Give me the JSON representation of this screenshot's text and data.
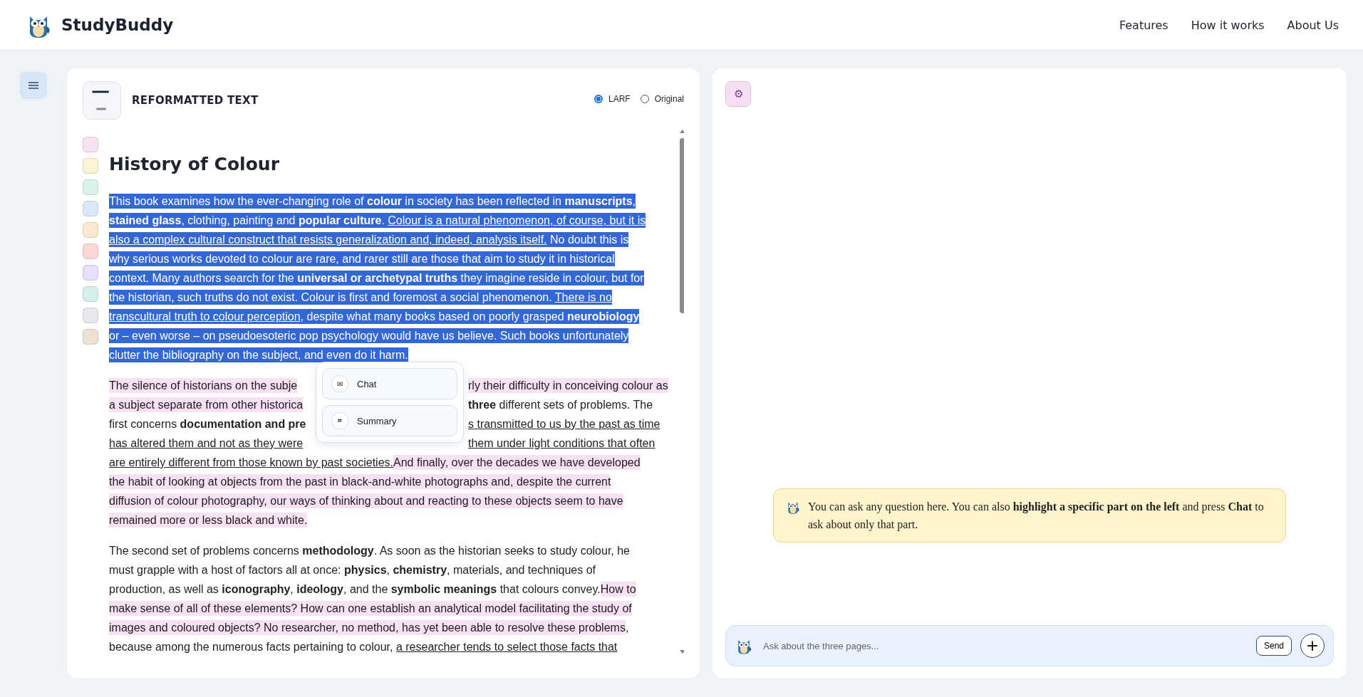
{
  "header": {
    "brand": "StudyBuddy",
    "nav": [
      {
        "label": "Features"
      },
      {
        "label": "How it works"
      },
      {
        "label": "About Us"
      }
    ]
  },
  "reader": {
    "title": "REFORMATTED TEXT",
    "modes": [
      {
        "label": "LARF",
        "selected": true
      },
      {
        "label": "Original",
        "selected": false
      }
    ],
    "swatches": [
      {
        "color": "#f7e3f4"
      },
      {
        "color": "#fcf3d3"
      },
      {
        "color": "#d8f5e7"
      },
      {
        "color": "#dbe8fb"
      },
      {
        "color": "#fde9cf"
      },
      {
        "color": "#fcd7d7"
      },
      {
        "color": "#e7dffb"
      },
      {
        "color": "#d4f1ee"
      },
      {
        "color": "#e8e9ee"
      },
      {
        "color": "#ece1d3"
      }
    ],
    "heading": "History of Colour",
    "paragraphs": [
      {
        "lines": [
          {
            "spans": [
              {
                "text": "This book examines how the ever-changing role of **colour** in society has been reflected in **manuscripts**,",
                "selected": true,
                "underline": false
              }
            ]
          },
          {
            "spans": [
              {
                "text": "**stained glass**, clothing, painting and **popular culture**. ",
                "selected": true,
                "underline": false
              },
              {
                "text": "Colour is a natural phenomenon, of course, but it is",
                "selected": true,
                "underline": true
              }
            ]
          },
          {
            "spans": [
              {
                "text": "also a complex cultural construct that resists generalization and, indeed, analysis itself.",
                "selected": true,
                "underline": true
              },
              {
                "text": " No doubt this is",
                "selected": true,
                "underline": false
              }
            ]
          },
          {
            "spans": [
              {
                "text": "why serious works devoted to colour are rare, and rarer still are those that aim to study it in historical",
                "selected": true,
                "underline": false
              }
            ]
          },
          {
            "spans": [
              {
                "text": "context. Many authors search for the **universal or archetypal truths** they imagine reside in colour, but for",
                "selected": true,
                "underline": false
              }
            ]
          },
          {
            "spans": [
              {
                "text": "the historian, such truths do not exist. Colour is first and foremost a social phenomenon. ",
                "selected": true,
                "underline": false
              },
              {
                "text": "There is no",
                "selected": true,
                "underline": true
              }
            ]
          },
          {
            "spans": [
              {
                "text": "transcultural truth to colour perception",
                "selected": true,
                "underline": true
              },
              {
                "text": ", despite what many books based on poorly grasped **neurobiology**",
                "selected": true,
                "underline": false
              }
            ]
          },
          {
            "spans": [
              {
                "text": "or – even worse – on pseudoesoteric pop psychology would have us believe. Such books unfortunately",
                "selected": true,
                "underline": false
              }
            ]
          },
          {
            "spans": [
              {
                "text": "clutter the bibliography on the subject, and even do it harm.",
                "selected": true,
                "underline": false
              }
            ]
          }
        ]
      },
      {
        "lines": [
          {
            "spans": [
              {
                "text": "The silence of historians on the subje",
                "selected": false,
                "highlighted": true,
                "underline": false
              },
              {
                "text": "rly their difficulty in conceiving colour as",
                "selected": false,
                "highlighted": true,
                "underline": false,
                "covered_before": true
              }
            ]
          },
          {
            "spans": [
              {
                "text": "a subject separate from other historica",
                "selected": false,
                "highlighted": true,
                "underline": false
              },
              {
                "text": "**three** different sets of problems. The",
                "selected": false,
                "highlighted": false,
                "underline": false,
                "covered_before": true
              }
            ]
          },
          {
            "spans": [
              {
                "text": "first concerns **documentation and pre**",
                "selected": false,
                "highlighted": false,
                "underline": false
              },
              {
                "text": "s transmitted to us by the past as time",
                "selected": false,
                "highlighted": false,
                "underline": true,
                "covered_before": true
              }
            ]
          },
          {
            "spans": [
              {
                "text": "has altered them and not as they were",
                "selected": false,
                "highlighted": false,
                "underline": true
              },
              {
                "text": "them under light conditions that often",
                "selected": false,
                "highlighted": false,
                "underline": true,
                "covered_before": true
              }
            ]
          },
          {
            "spans": [
              {
                "text": "are entirely different from those known by past societies.",
                "selected": false,
                "highlighted": false,
                "underline": true
              },
              {
                "text": "And finally, over the decades we have developed",
                "selected": false,
                "highlighted": true,
                "underline": false
              }
            ]
          },
          {
            "spans": [
              {
                "text": "the habit of looking at objects from the past in black-and-white photographs and, despite the current",
                "selected": false,
                "highlighted": true,
                "underline": false
              }
            ]
          },
          {
            "spans": [
              {
                "text": "diffusion of colour photography, our ways of thinking about and reacting to these objects seem to have",
                "selected": false,
                "highlighted": true,
                "underline": false
              }
            ]
          },
          {
            "spans": [
              {
                "text": "remained more or less black and white.",
                "selected": false,
                "highlighted": true,
                "underline": false
              }
            ]
          }
        ]
      },
      {
        "lines": [
          {
            "spans": [
              {
                "text": "The second set of problems concerns **methodology**. As soon as the historian seeks to study colour, he",
                "selected": false,
                "highlighted": false,
                "underline": false
              }
            ]
          },
          {
            "spans": [
              {
                "text": "must grapple with a host of factors all at once: **physics**, **chemistry**, materials, and techniques of",
                "selected": false,
                "highlighted": false,
                "underline": false
              }
            ]
          },
          {
            "spans": [
              {
                "text": "production, as well as **iconography**, **ideology**, and the **symbolic meanings** that colours convey.",
                "selected": false,
                "highlighted": false,
                "underline": false
              },
              {
                "text": "How to",
                "selected": false,
                "highlighted": true,
                "underline": false
              }
            ]
          },
          {
            "spans": [
              {
                "text": "make sense of all of these elements? How can one establish an analytical model facilitating the study of",
                "selected": false,
                "highlighted": true,
                "underline": false
              }
            ]
          },
          {
            "spans": [
              {
                "text": "images and coloured objects? No researcher, no method, has yet been able to resolve these problems",
                "selected": false,
                "highlighted": true,
                "underline": false
              },
              {
                "text": ",",
                "selected": false,
                "highlighted": false
              }
            ]
          },
          {
            "spans": [
              {
                "text": "because among the numerous facts pertaining to colour, ",
                "selected": false,
                "highlighted": false,
                "underline": false
              },
              {
                "text": "a researcher tends to select those facts that",
                "selected": false,
                "highlighted": false,
                "underline": true
              }
            ]
          }
        ]
      }
    ]
  },
  "popup": {
    "actions": [
      {
        "icon": "✉",
        "label": "Chat"
      },
      {
        "icon": "⌗",
        "label": "Summary"
      }
    ]
  },
  "chat": {
    "settings_icon": "⚙",
    "tip": "You can ask any question here. You can also **highlight a specific part on the left** and press **Chat** to ask about only that part.",
    "input": {
      "placeholder": "Ask about the three pages..."
    },
    "send": "Send",
    "add": "+"
  }
}
